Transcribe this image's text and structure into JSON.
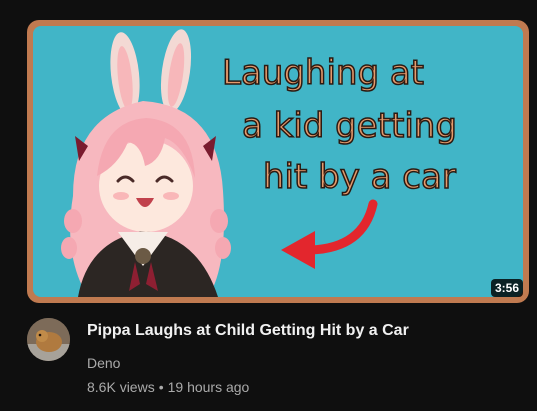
{
  "thumbnail": {
    "overlay_lines": [
      "Laughing at",
      "a kid getting",
      "hit by a car"
    ],
    "duration": "3:56",
    "colors": {
      "frame": "#c07a50",
      "background": "#41b5c7",
      "overlay_text": "#e59a6c",
      "arrow": "#e3262d"
    },
    "icons": [
      "character-illustration",
      "red-arrow-icon"
    ]
  },
  "video": {
    "title": "Pippa Laughs at Child Getting Hit by a Car",
    "channel": "Deno",
    "views": "8.6K views",
    "separator": "•",
    "age": "19 hours ago"
  },
  "avatar": {
    "icon": "channel-avatar"
  }
}
